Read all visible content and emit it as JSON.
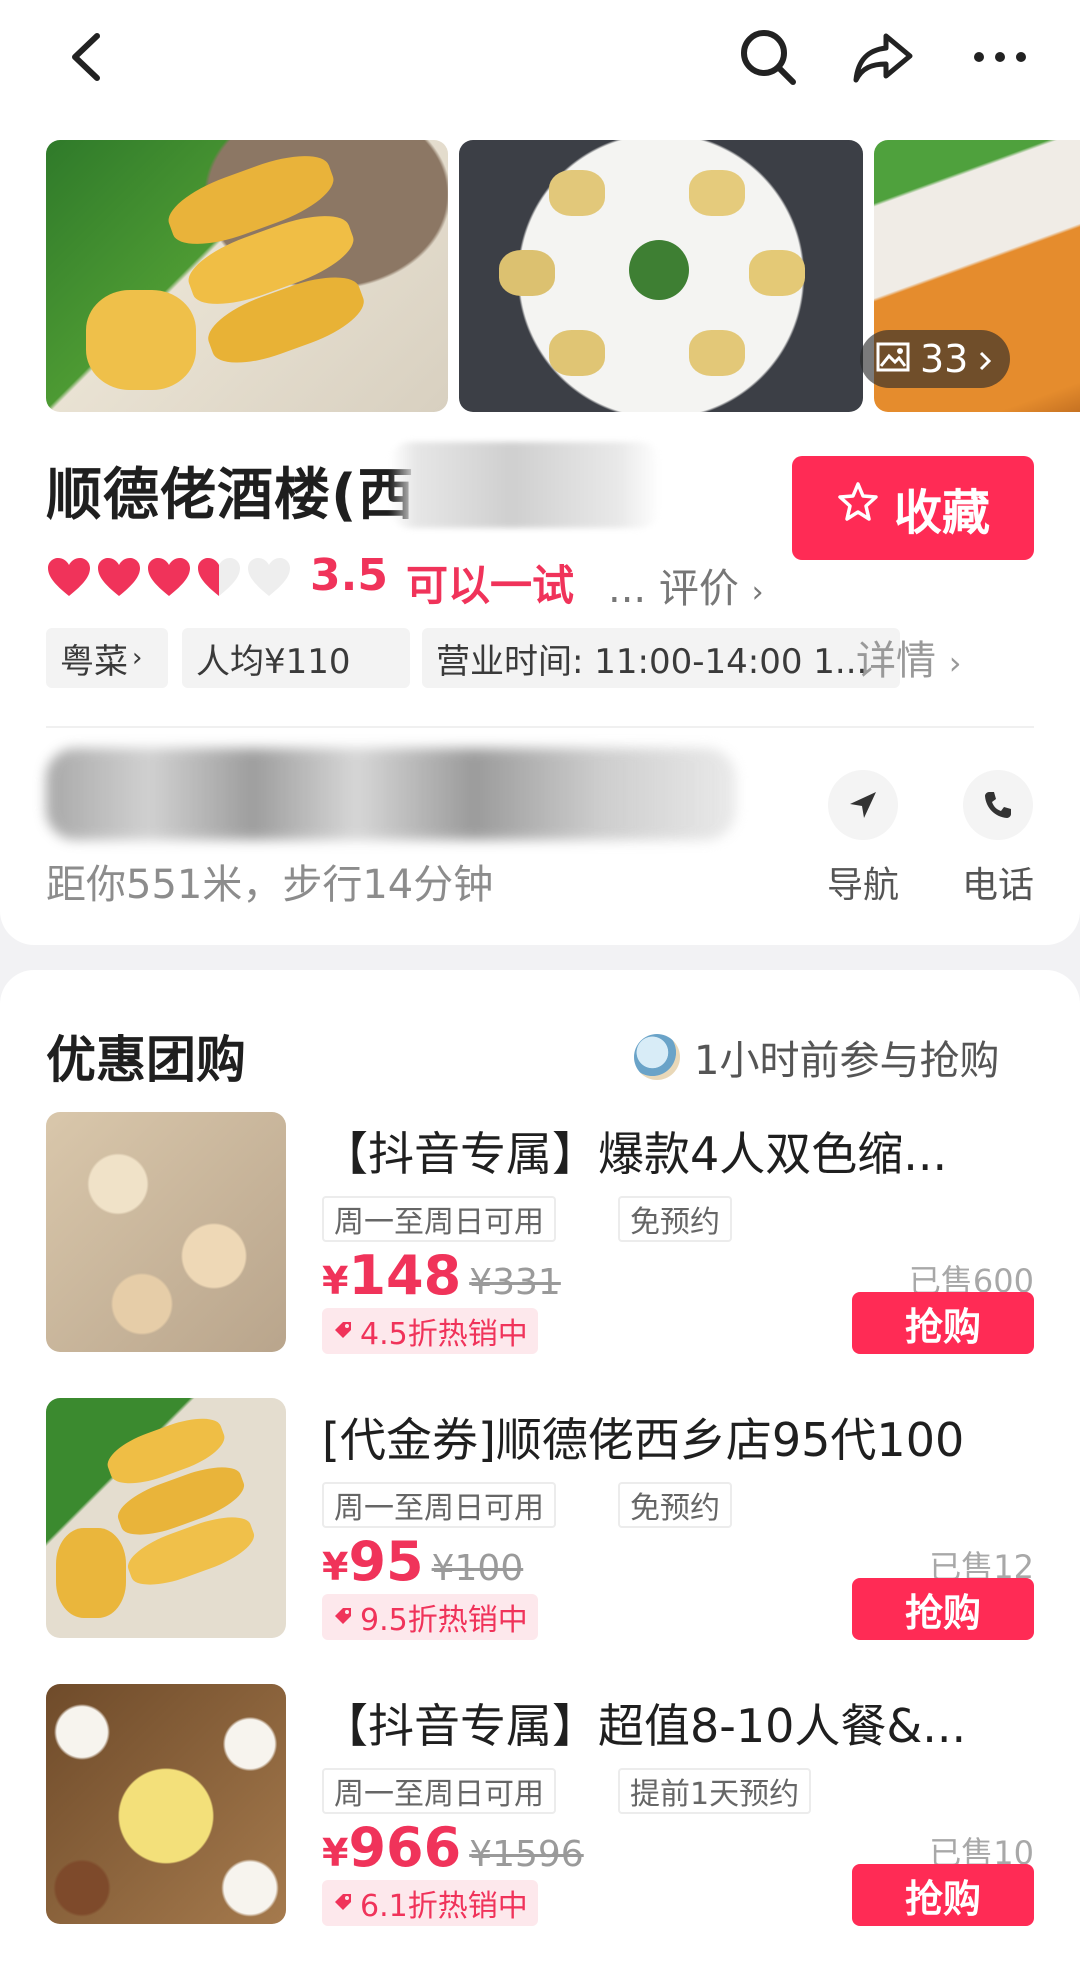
{
  "header": {
    "back_icon": "back-icon",
    "search_icon": "search-icon",
    "share_icon": "share-icon",
    "more_icon": "more-icon"
  },
  "gallery": {
    "photo_count": "33"
  },
  "shop": {
    "name": "顺德佬酒楼(西",
    "favorite_label": "收藏",
    "rating_hearts": 3.5,
    "rating_score": "3.5",
    "rating_text": "可以一试",
    "review_link": "... 评价",
    "tags": [
      "粤菜",
      "人均¥110",
      "营业时间: 11:00-14:00 1..."
    ],
    "detail_label": "详情",
    "distance": "距你551米，步行14分钟",
    "navigate_label": "导航",
    "call_label": "电话"
  },
  "deals": {
    "section_title": "优惠团购",
    "recent_purchase": "1小时前参与抢购",
    "items": [
      {
        "name": "【抖音专属】爆款4人双色缩...",
        "chips": [
          "周一至周日可用",
          "免预约"
        ],
        "currency": "¥",
        "price": "148",
        "original": "¥331",
        "discount": "4.5折热销中",
        "sold": "已售600",
        "buy_label": "抢购"
      },
      {
        "name": "[代金券]顺德佬西乡店95代100",
        "chips": [
          "周一至周日可用",
          "免预约"
        ],
        "currency": "¥",
        "price": "95",
        "original": "¥100",
        "discount": "9.5折热销中",
        "sold": "已售12",
        "buy_label": "抢购"
      },
      {
        "name": "【抖音专属】超值8-10人餐&...",
        "chips": [
          "周一至周日可用",
          "提前1天预约"
        ],
        "currency": "¥",
        "price": "966",
        "original": "¥1596",
        "discount": "6.1折热销中",
        "sold": "已售10",
        "buy_label": "抢购"
      }
    ]
  },
  "colors": {
    "accent": "#ff2b55",
    "price": "#f0335a"
  }
}
